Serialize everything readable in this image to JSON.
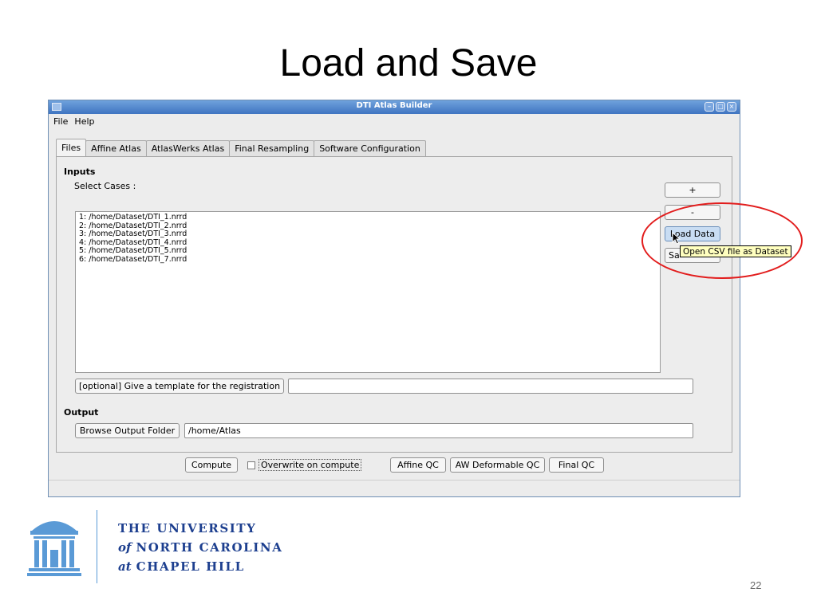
{
  "slide": {
    "title": "Load and Save",
    "page_number": "22"
  },
  "window": {
    "title": "DTI Atlas Builder",
    "menu": [
      "File",
      "Help"
    ],
    "tabs": [
      "Files",
      "Affine Atlas",
      "AtlasWerks Atlas",
      "Final Resampling",
      "Software Configuration"
    ],
    "active_tab": "Files",
    "inputs_heading": "Inputs",
    "select_cases_label": "Select Cases :",
    "cases": [
      "1: /home/Dataset/DTI_1.nrrd",
      "2: /home/Dataset/DTI_2.nrrd",
      "3: /home/Dataset/DTI_3.nrrd",
      "4: /home/Dataset/DTI_4.nrrd",
      "5: /home/Dataset/DTI_5.nrrd",
      "6: /home/Dataset/DTI_7.nrrd"
    ],
    "side_buttons": {
      "add": "+",
      "remove": "-",
      "load": "Load Data",
      "save": "Sa"
    },
    "tooltip": "Open CSV file as Dataset",
    "template_button": "[optional] Give a template for the registration",
    "template_value": "",
    "output_heading": "Output",
    "browse_button": "Browse Output Folder",
    "output_value": "/home/Atlas",
    "bottom": {
      "compute": "Compute",
      "overwrite": "Overwrite on compute",
      "affine_qc": "Affine QC",
      "aw_qc": "AW Deformable QC",
      "final_qc": "Final QC"
    }
  },
  "logo": {
    "line1": "THE UNIVERSITY",
    "line2_prefix": "of",
    "line2": "NORTH CAROLINA",
    "line3_prefix": "at",
    "line3": "CHAPEL HILL"
  },
  "colors": {
    "titlebar": "#3f74c1",
    "highlight_circle": "#e21d1d",
    "tooltip_bg": "#ffffbf",
    "unc_blue": "#1d3f8f"
  }
}
